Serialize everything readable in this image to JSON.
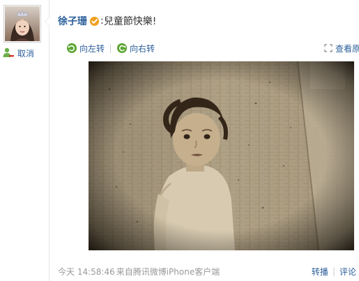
{
  "user": {
    "name": "徐子珊",
    "unfollow_label": "取消"
  },
  "post": {
    "text": "兒童節快樂!",
    "colon": ":"
  },
  "image_toolbar": {
    "rotate_left": "向左转",
    "rotate_right": "向右转",
    "view_original": "查看原"
  },
  "footer": {
    "time": "今天 14:58:46",
    "source": "来自腾讯微博iPhone客户端",
    "repost": "转播",
    "separator": "|",
    "comment": "评论"
  },
  "icons": {
    "unfollow": "person-minus-icon",
    "verified": "verified-badge-icon",
    "rotate_left": "rotate-left-icon",
    "rotate_right": "rotate-right-icon",
    "view_original": "enlarge-icon"
  },
  "colors": {
    "link": "#2b5f9a",
    "meta": "#999999",
    "verified": "#f0a020",
    "rotate_icon": "#5aa531"
  }
}
